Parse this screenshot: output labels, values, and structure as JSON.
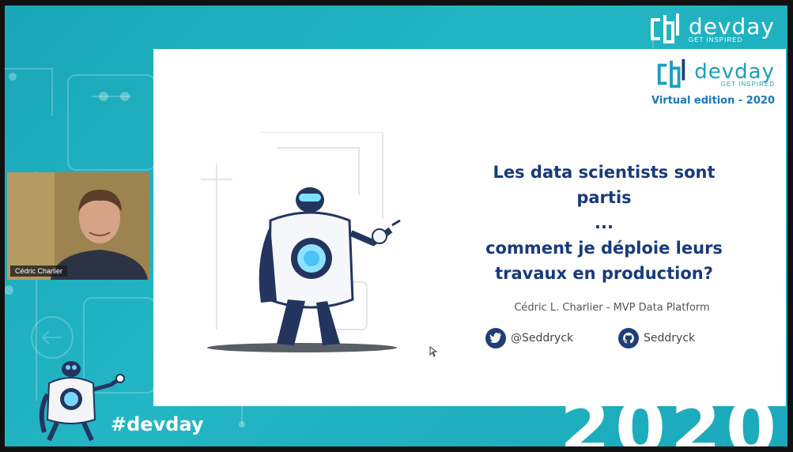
{
  "window": {
    "title": "devday Virtual edition 2020 stream"
  },
  "background": {
    "brand": "devday",
    "tagline": "GET INSPIRED",
    "year": "2020",
    "hashtag": "#devday",
    "colors": {
      "teal": "#1aa7b8",
      "navy": "#1f3e78"
    }
  },
  "webcam": {
    "name": "Cédric Charlier"
  },
  "slide": {
    "brand": "devday",
    "tagline": "GET INSPIRED",
    "edition": "Virtual edition - 2020",
    "title_lines": [
      "Les data scientists sont",
      "partis",
      "...",
      "comment je déploie leurs",
      "travaux en production?"
    ],
    "speaker": "Cédric L. Charlier  -  MVP Data Platform",
    "twitter": {
      "icon": "twitter-icon",
      "handle": "@Seddryck"
    },
    "github": {
      "icon": "github-icon",
      "handle": "Seddryck"
    }
  }
}
